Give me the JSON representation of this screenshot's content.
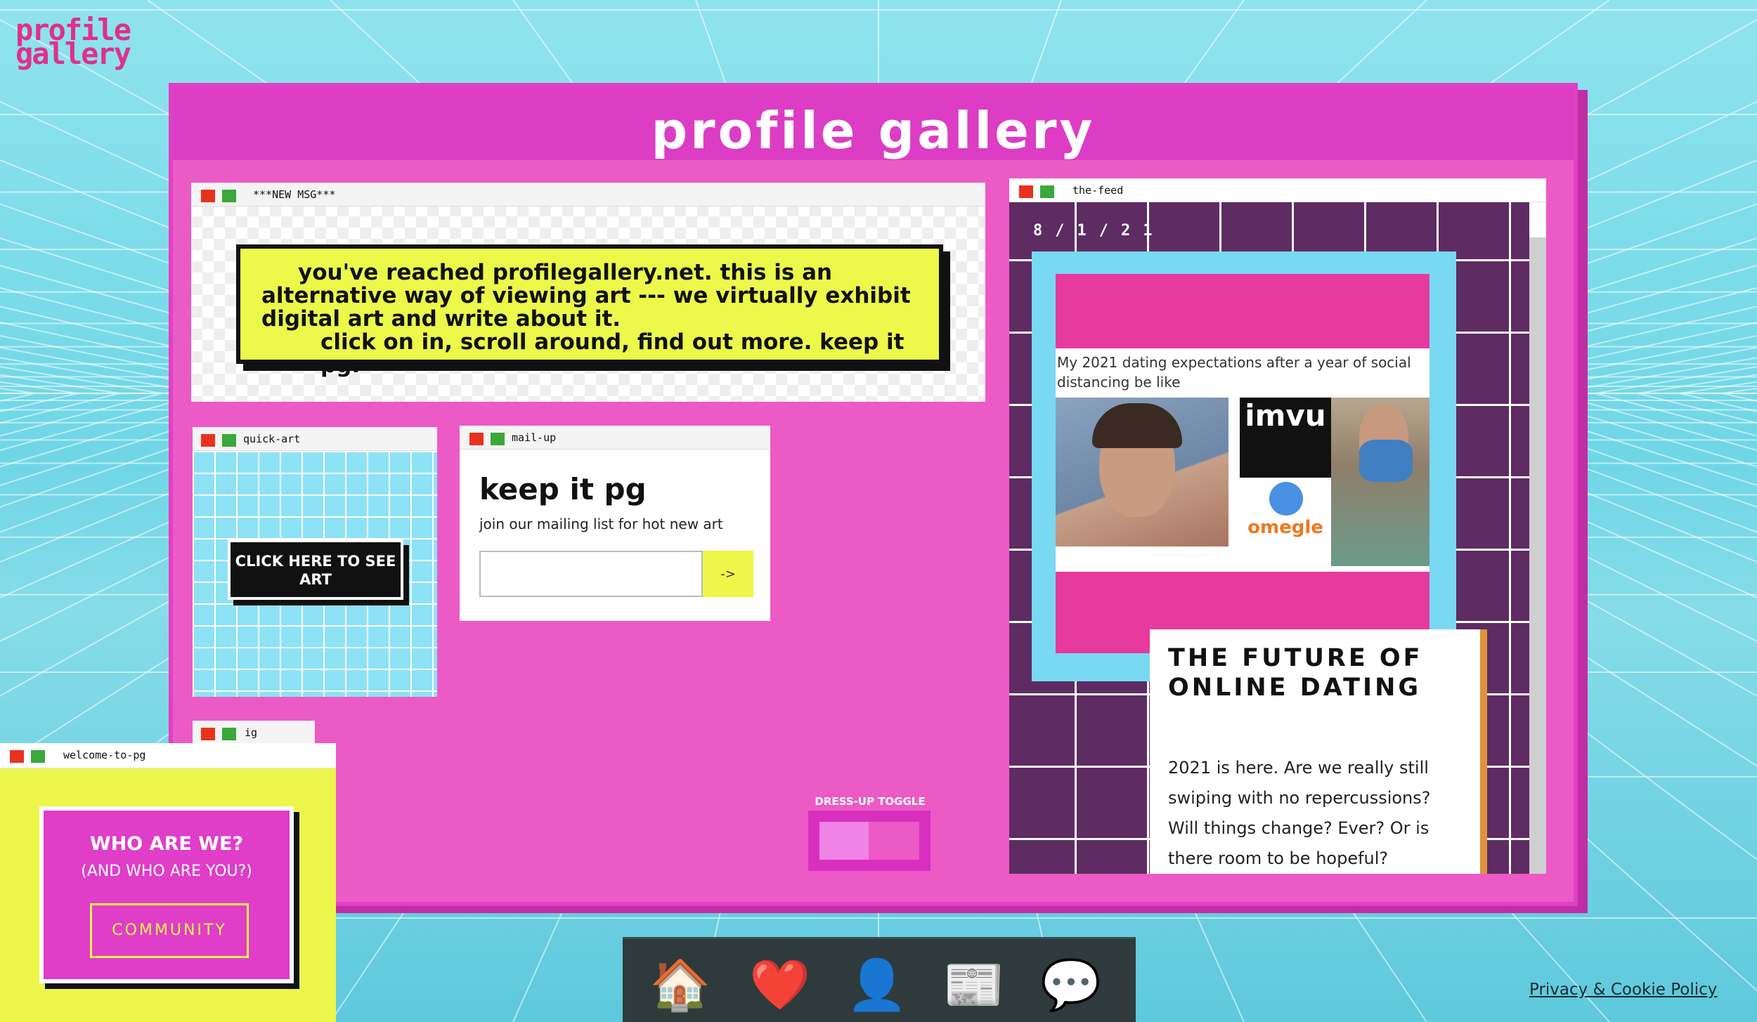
{
  "logo": {
    "line1": "profile",
    "line2": "gallery"
  },
  "board": {
    "title": "profile gallery"
  },
  "windows": {
    "new_msg": {
      "title": "***NEW MSG***",
      "lines": [
        "you've reached profilegallery.net. this is an",
        "alternative way of viewing art --- we virtually exhibit",
        "digital art and write about it.",
        "click on in, scroll around, find out more. keep it pg."
      ]
    },
    "quick_art": {
      "title": "quick-art",
      "button_label": "CLICK HERE TO SEE ART"
    },
    "mail_up": {
      "title": "mail-up",
      "heading": "keep it pg",
      "subheading": "join our mailing list for hot new art",
      "input_value": "",
      "submit_label": "->"
    },
    "the_feed": {
      "title": "the-feed",
      "date": "8/1/21",
      "post_text": "My 2021 dating expectations after a year of social distancing be like",
      "imvu_logo": "imvu",
      "omegle_logo": "omegle",
      "article_title": "THE FUTURE OF ONLINE DATING",
      "article_body": "2021 is here. Are we really still swiping with no repercussions? Will things change? Ever? Or is there room to be hopeful?"
    },
    "ig": {
      "title": "ig"
    },
    "welcome": {
      "title": "welcome-to-pg",
      "heading": "WHO ARE WE?",
      "subheading": "(AND WHO ARE YOU?)",
      "button_label": "COMMUNITY"
    }
  },
  "dress_up": {
    "label": "DRESS-UP TOGGLE"
  },
  "dock": {
    "items": [
      {
        "icon": "house-icon",
        "glyph": "🏠"
      },
      {
        "icon": "heart-icon",
        "glyph": "❤️"
      },
      {
        "icon": "bust-icon",
        "glyph": "👤"
      },
      {
        "icon": "newspaper-icon",
        "glyph": "📰"
      },
      {
        "icon": "speech-bubble-icon",
        "glyph": "💬"
      }
    ]
  },
  "footer": {
    "privacy_link": "Privacy & Cookie Policy"
  },
  "colors": {
    "accent": "#e040c2",
    "yellow": "#edf64b",
    "cyan": "#8fdff2",
    "purple": "#5e2b62"
  }
}
